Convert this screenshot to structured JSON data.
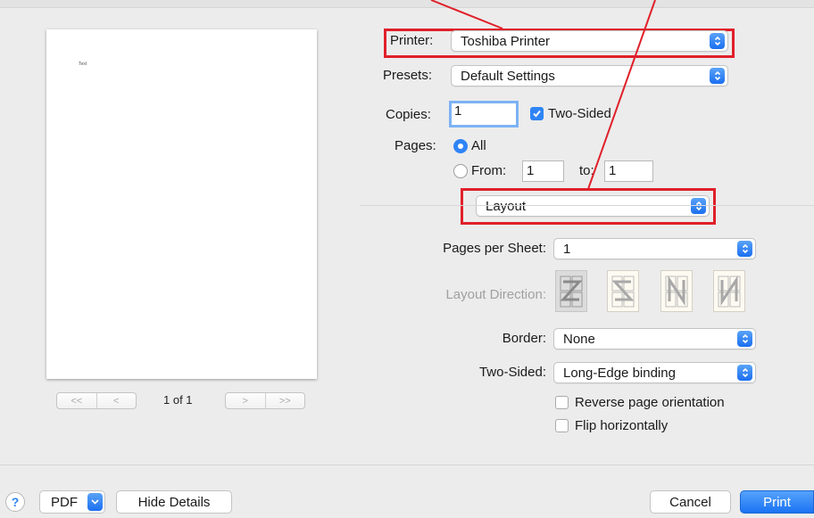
{
  "preview": {
    "sample_text": "Text",
    "page_count": "1 of 1",
    "nav_first": "<<",
    "nav_prev": "<",
    "nav_next": ">",
    "nav_last": ">>"
  },
  "printer": {
    "label": "Printer:",
    "value": "Toshiba Printer"
  },
  "presets": {
    "label": "Presets:",
    "value": "Default Settings"
  },
  "copies": {
    "label": "Copies:",
    "value": "1",
    "two_sided_label": "Two-Sided",
    "two_sided_checked": true
  },
  "pages": {
    "label": "Pages:",
    "all_label": "All",
    "from_label": "From:",
    "from_value": "1",
    "to_label": "to:",
    "to_value": "1"
  },
  "section": {
    "value": "Layout"
  },
  "layout": {
    "pages_per_sheet_label": "Pages per Sheet:",
    "pages_per_sheet_value": "1",
    "direction_label": "Layout Direction:",
    "border_label": "Border:",
    "border_value": "None",
    "two_sided_label": "Two-Sided:",
    "two_sided_value": "Long-Edge binding",
    "reverse_label": "Reverse page orientation",
    "flip_label": "Flip horizontally"
  },
  "footer": {
    "help": "?",
    "pdf": "PDF",
    "hide_details": "Hide Details",
    "cancel": "Cancel",
    "print": "Print"
  },
  "colors": {
    "accent": "#2f84f5",
    "annotation": "#e0202a"
  },
  "icons": [
    "help-icon",
    "popup-arrows-icon",
    "checkmark-icon",
    "layout-direction-icon",
    "chevron-down-icon"
  ]
}
